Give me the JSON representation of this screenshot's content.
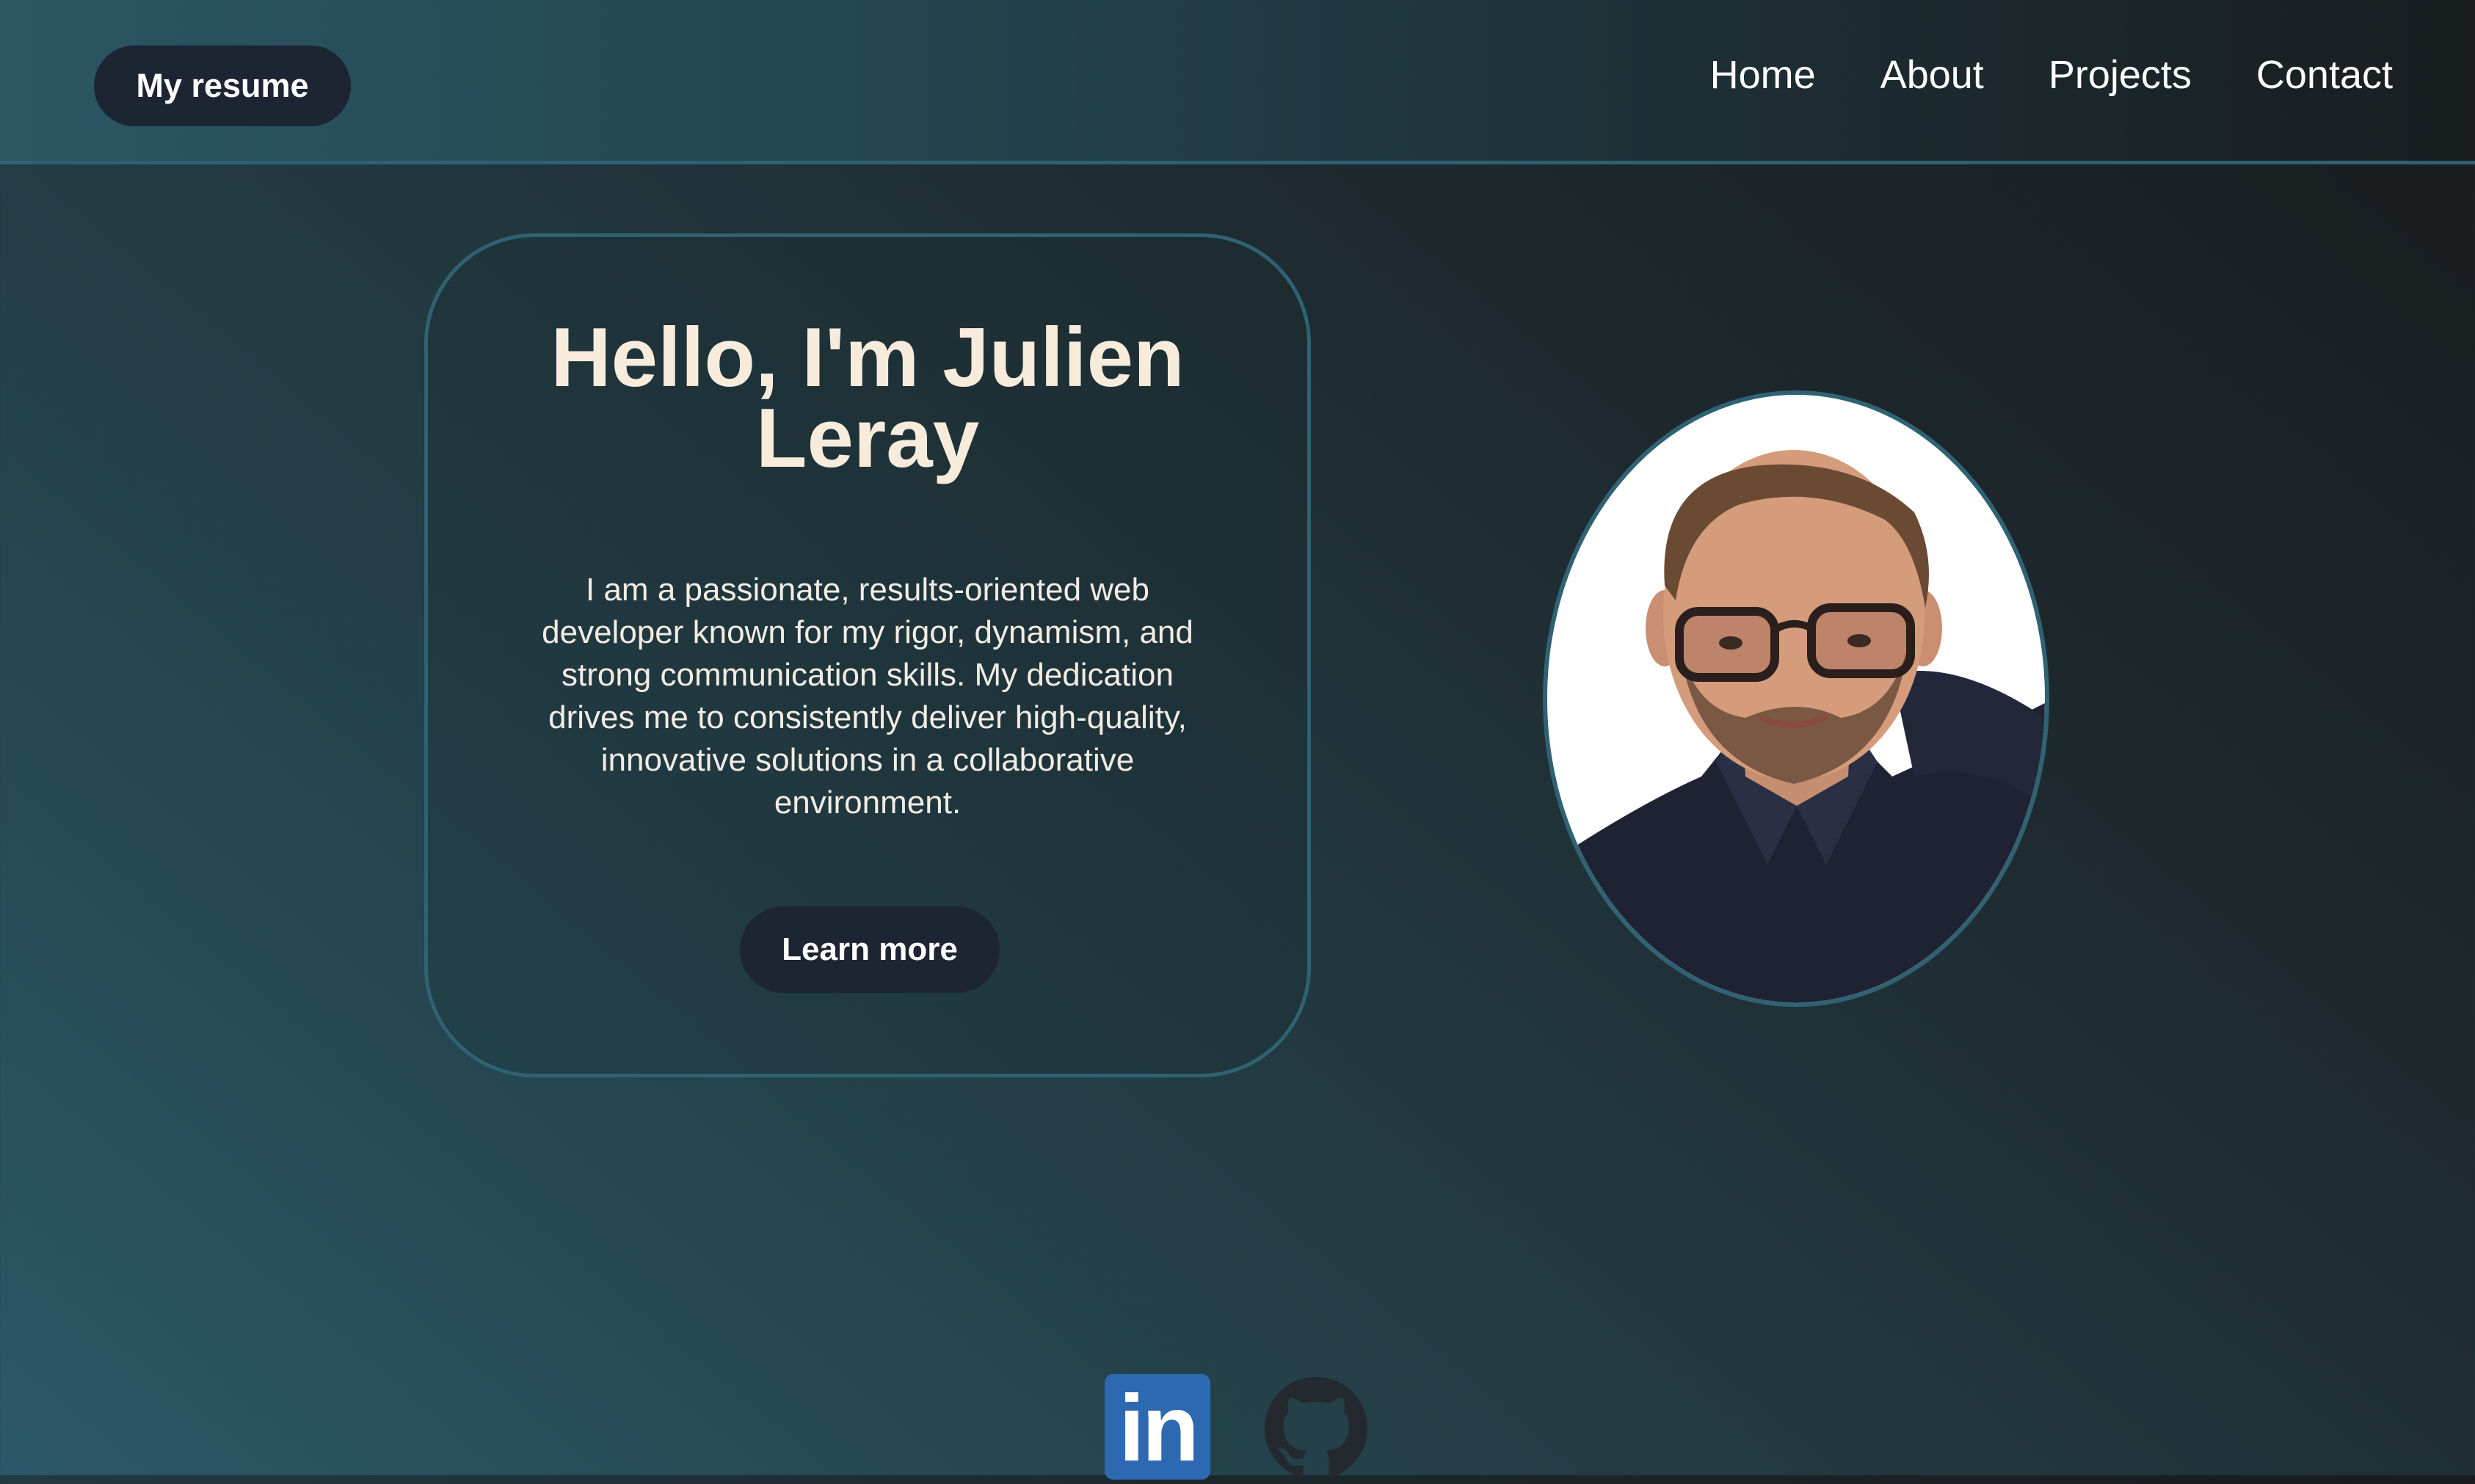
{
  "header": {
    "brand_label": "My resume",
    "nav": [
      {
        "label": "Home"
      },
      {
        "label": "About"
      },
      {
        "label": "Projects"
      },
      {
        "label": "Contact"
      }
    ]
  },
  "hero": {
    "title": "Hello, I'm Julien Leray",
    "description": "I am a passionate, results-oriented web developer known for my rigor, dynamism, and strong communication skills. My dedication drives me to consistently deliver high-quality, innovative solutions in a collaborative environment.",
    "button_label": "Learn more"
  },
  "social": {
    "linkedin_label": "in",
    "icons": [
      "linkedin-icon",
      "github-icon"
    ]
  },
  "colors": {
    "accent_border": "#2f6272",
    "button_bg": "#1d2533",
    "title_text": "#f7ecdc",
    "linkedin_blue": "#2d69b1"
  }
}
